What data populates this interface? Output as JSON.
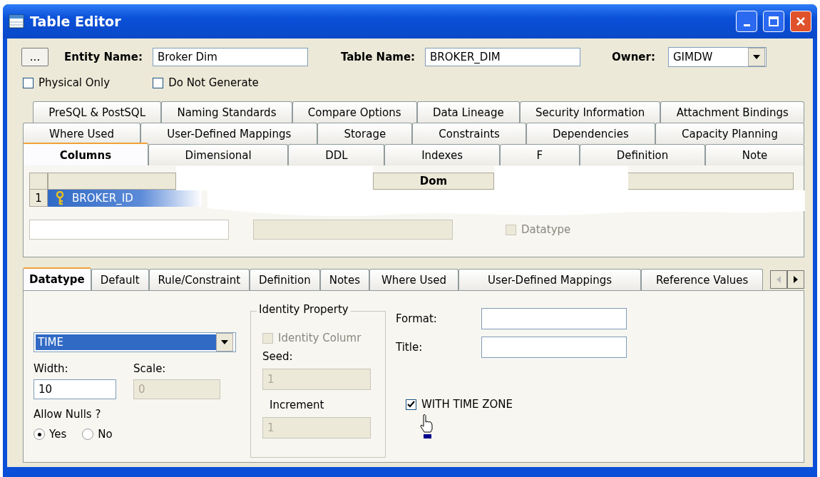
{
  "window": {
    "title": "Table Editor"
  },
  "header": {
    "browse_button": "...",
    "entity_name": {
      "label": "Entity Name:",
      "value": "Broker Dim"
    },
    "table_name": {
      "label": "Table Name:",
      "value": "BROKER_DIM"
    },
    "owner": {
      "label": "Owner:",
      "value": "GIMDW"
    }
  },
  "options": [
    {
      "label": "Physical Only",
      "checked": false
    },
    {
      "label": "Do Not Generate",
      "checked": false
    }
  ],
  "tab_rows": [
    [
      {
        "label": "PreSQL & PostSQL",
        "selected": false
      },
      {
        "label": "Naming Standards",
        "selected": false
      },
      {
        "label": "Compare Options",
        "selected": false
      },
      {
        "label": "Data Lineage",
        "selected": false
      },
      {
        "label": "Security Information",
        "selected": false
      },
      {
        "label": "Attachment Bindings",
        "selected": false
      }
    ],
    [
      {
        "label": "Where Used",
        "selected": false
      },
      {
        "label": "User-Defined Mappings",
        "selected": false
      },
      {
        "label": "Storage",
        "selected": false
      },
      {
        "label": "Constraints",
        "selected": false
      },
      {
        "label": "Dependencies",
        "selected": false
      },
      {
        "label": "Capacity Planning",
        "selected": false
      }
    ],
    [
      {
        "label": "Columns",
        "selected": true
      },
      {
        "label": "Dimensional",
        "selected": false
      },
      {
        "label": "DDL",
        "selected": false
      },
      {
        "label": "Indexes",
        "selected": false
      },
      {
        "label": "F",
        "selected": false
      },
      {
        "label": "Definition",
        "selected": false
      },
      {
        "label": "Note",
        "selected": false
      }
    ]
  ],
  "grid": {
    "column_header": "Dom",
    "rows": [
      {
        "number": "1",
        "name": "BROKER_ID",
        "selected": true
      }
    ]
  },
  "column_option": {
    "label": "Datatype",
    "checked": false
  },
  "detail_tabs": [
    {
      "label": "Datatype",
      "selected": true
    },
    {
      "label": "Default",
      "selected": false
    },
    {
      "label": "Rule/Constraint",
      "selected": false
    },
    {
      "label": "Definition",
      "selected": false
    },
    {
      "label": "Notes",
      "selected": false
    },
    {
      "label": "Where Used",
      "selected": false
    },
    {
      "label": "User-Defined Mappings",
      "selected": false
    },
    {
      "label": "Reference Values",
      "selected": false
    }
  ],
  "datatype": {
    "value": "TIME"
  },
  "width": {
    "label": "Width:",
    "value": "10"
  },
  "scale": {
    "label": "Scale:",
    "value": "0",
    "disabled": true
  },
  "allow_nulls": {
    "label": "Allow Nulls ?",
    "options": [
      {
        "label": "Yes",
        "selected": true
      },
      {
        "label": "No",
        "selected": false
      }
    ]
  },
  "identity": {
    "title": "Identity Property",
    "identity_column": {
      "label": "Identity Columr",
      "checked": false,
      "disabled": true
    },
    "seed": {
      "label": "Seed:",
      "value": "1",
      "disabled": true
    },
    "increment": {
      "label": "Increment",
      "value": "1",
      "disabled": true
    }
  },
  "format": {
    "label": "Format:"
  },
  "title_field": {
    "label": "Title:"
  },
  "with_time_zone": {
    "label": "WITH TIME ZONE",
    "checked": true
  }
}
